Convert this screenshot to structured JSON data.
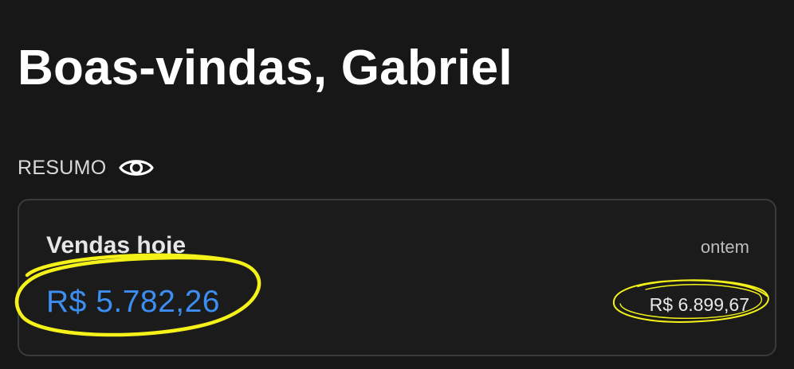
{
  "header": {
    "greeting": "Boas-vindas, Gabriel"
  },
  "summary": {
    "label": "RESUMO",
    "toggle_icon": "eye-icon"
  },
  "sales_card": {
    "title": "Vendas hoje",
    "today_value": "R$ 5.782,26",
    "yesterday_label": "ontem",
    "yesterday_value": "R$ 6.899,67"
  },
  "colors": {
    "background": "#171717",
    "accent_blue": "#3d8ef2",
    "highlight_yellow": "#f5f21a",
    "card_border": "#3a3a3a"
  }
}
